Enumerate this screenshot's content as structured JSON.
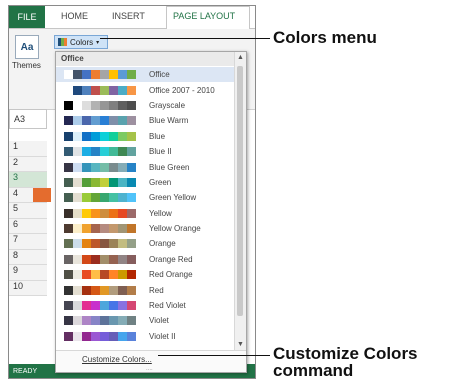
{
  "tabs": {
    "file": "FILE",
    "home": "HOME",
    "insert": "INSERT",
    "page_layout": "PAGE LAYOUT"
  },
  "ribbon": {
    "themes_icon_text": "Aa",
    "themes_label": "Themes",
    "colors_button": "Colors"
  },
  "sheet": {
    "name_box": "A3",
    "rows": [
      "1",
      "2",
      "3",
      "4",
      "5",
      "6",
      "7",
      "8",
      "9",
      "10"
    ],
    "status": "READY"
  },
  "dropdown": {
    "header": "Office",
    "items": [
      {
        "label": "Office",
        "colors": [
          "#ffffff",
          "#44546a",
          "#4472c4",
          "#ed7d31",
          "#a5a5a5",
          "#ffc000",
          "#5b9bd5",
          "#70ad47"
        ]
      },
      {
        "label": "Office 2007 - 2010",
        "colors": [
          "#ffffff",
          "#1f497d",
          "#4f81bd",
          "#c0504d",
          "#9bbb59",
          "#8064a2",
          "#4bacc6",
          "#f79646"
        ]
      },
      {
        "label": "Grayscale",
        "colors": [
          "#000000",
          "#ffffff",
          "#dddddd",
          "#b2b2b2",
          "#969696",
          "#808080",
          "#5f5f5f",
          "#4d4d4d"
        ]
      },
      {
        "label": "Blue Warm",
        "colors": [
          "#242852",
          "#acccea",
          "#4a66ac",
          "#629dd1",
          "#297fd5",
          "#7f8fa9",
          "#5aa2ae",
          "#9d90a0"
        ]
      },
      {
        "label": "Blue",
        "colors": [
          "#17406d",
          "#dbeff9",
          "#0f6fc6",
          "#009dd9",
          "#0bd0d9",
          "#10cf9b",
          "#7cca62",
          "#a5c249"
        ]
      },
      {
        "label": "Blue II",
        "colors": [
          "#335b74",
          "#dfe3e5",
          "#1cade4",
          "#2683c6",
          "#27ced7",
          "#42ba97",
          "#3e8853",
          "#62a39f"
        ]
      },
      {
        "label": "Blue Green",
        "colors": [
          "#373545",
          "#ceddf2",
          "#3494ba",
          "#58b6c0",
          "#75bda7",
          "#7a8c8e",
          "#84acb6",
          "#2683c6"
        ]
      },
      {
        "label": "Green",
        "colors": [
          "#455f51",
          "#e3ded1",
          "#549e39",
          "#8ab833",
          "#c0cf3a",
          "#029676",
          "#4ab5c4",
          "#0989b1"
        ]
      },
      {
        "label": "Green Yellow",
        "colors": [
          "#455f51",
          "#e3ded1",
          "#99cb38",
          "#63a537",
          "#37a76f",
          "#44c1a3",
          "#4eb3cf",
          "#51c3f9"
        ]
      },
      {
        "label": "Yellow",
        "colors": [
          "#39302a",
          "#e5dec8",
          "#ffca08",
          "#f8931d",
          "#ce8d3e",
          "#ec7016",
          "#e64823",
          "#9c6a6a"
        ]
      },
      {
        "label": "Yellow Orange",
        "colors": [
          "#4e3b30",
          "#fbeec9",
          "#f0a22e",
          "#a5644e",
          "#b58b80",
          "#c3986d",
          "#a19574",
          "#c17529"
        ]
      },
      {
        "label": "Orange",
        "colors": [
          "#637052",
          "#ccddea",
          "#e48312",
          "#bd582c",
          "#865640",
          "#9b8357",
          "#c2bc80",
          "#94a088"
        ]
      },
      {
        "label": "Orange Red",
        "colors": [
          "#696464",
          "#e9e5dc",
          "#d34817",
          "#9b2d1f",
          "#a28e6a",
          "#956251",
          "#918485",
          "#855d5d"
        ]
      },
      {
        "label": "Red Orange",
        "colors": [
          "#505046",
          "#eeece1",
          "#e84c22",
          "#ffbd47",
          "#b64926",
          "#ff8427",
          "#cc9900",
          "#b22600"
        ]
      },
      {
        "label": "Red",
        "colors": [
          "#323232",
          "#e3ded1",
          "#a5300f",
          "#d55816",
          "#e19825",
          "#b19c7d",
          "#7f5f52",
          "#b27d49"
        ]
      },
      {
        "label": "Red Violet",
        "colors": [
          "#454551",
          "#d8d9dc",
          "#e32d91",
          "#c830cc",
          "#4ea6dc",
          "#4775e7",
          "#8971e1",
          "#d54773"
        ]
      },
      {
        "label": "Violet",
        "colors": [
          "#373545",
          "#dcd8dc",
          "#ad84c6",
          "#8784c7",
          "#5d739a",
          "#6997af",
          "#84acb6",
          "#6f8183"
        ]
      },
      {
        "label": "Violet II",
        "colors": [
          "#632e62",
          "#eae5eb",
          "#92278f",
          "#9b57d3",
          "#755dd9",
          "#665eb8",
          "#45a5ed",
          "#5982db"
        ]
      }
    ],
    "footer": "Customize Colors...",
    "grip": "....",
    "scroll_up": "▲",
    "scroll_down": "▼"
  },
  "callouts": {
    "colors_menu": "Colors menu",
    "customize_line1": "Customize Colors",
    "customize_line2": "command"
  }
}
